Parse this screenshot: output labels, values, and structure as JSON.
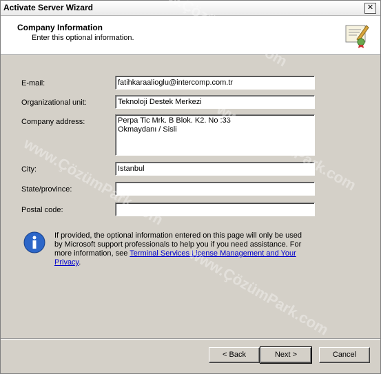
{
  "window": {
    "title": "Activate Server Wizard",
    "close_glyph": "✕"
  },
  "header": {
    "title": "Company Information",
    "subtitle": "Enter this optional information."
  },
  "form": {
    "email": {
      "label": "E-mail:",
      "value": "fatihkaraalioglu@intercomp.com.tr"
    },
    "org_unit": {
      "label": "Organizational unit:",
      "value": "Teknoloji Destek Merkezi"
    },
    "address": {
      "label": "Company address:",
      "value": "Perpa Tic Mrk. B Blok. K2. No :33\nOkmaydanı / Sisli"
    },
    "city": {
      "label": "City:",
      "value": "Istanbul"
    },
    "state": {
      "label": "State/province:",
      "value": ""
    },
    "postal": {
      "label": "Postal code:",
      "value": ""
    }
  },
  "info": {
    "text": "If provided, the optional information entered on this page will only be used by Microsoft support professionals to help you if you need assistance. For more information, see ",
    "link": "Terminal Services License Management and Your Privacy",
    "suffix": "."
  },
  "buttons": {
    "back": "< Back",
    "next": "Next >",
    "cancel": "Cancel"
  },
  "watermarks": [
    "www.ÇözümPark.com",
    "www.ÇözümPark.com",
    "www.ÇözümPark.com",
    "www.ÇözümPark.com"
  ]
}
